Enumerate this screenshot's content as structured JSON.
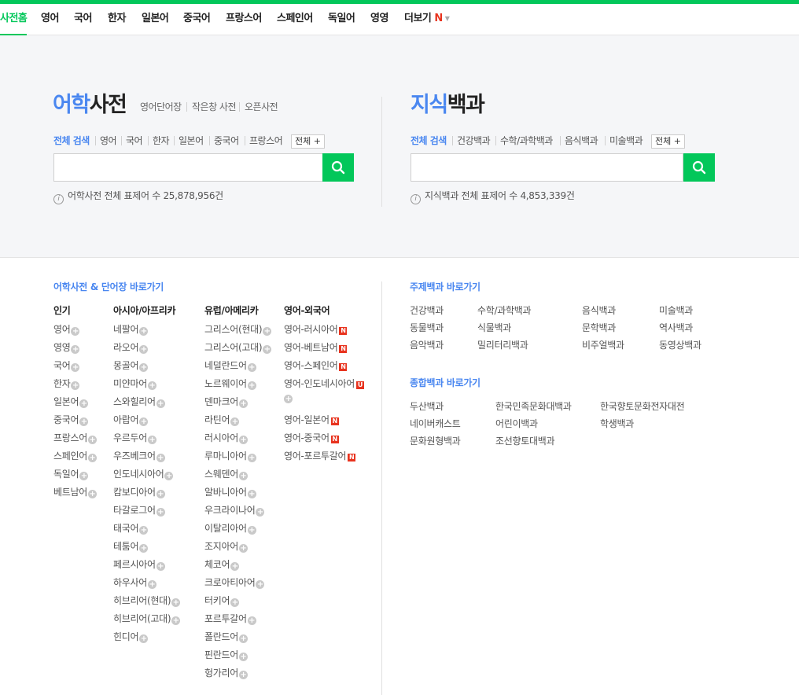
{
  "nav": {
    "tabs": [
      "사전홈",
      "영어",
      "국어",
      "한자",
      "일본어",
      "중국어",
      "프랑스어",
      "스페인어",
      "독일어",
      "영영"
    ],
    "more_label": "더보기",
    "more_badge": "N"
  },
  "language_dict": {
    "title_highlight": "어학",
    "title_rest": "사전",
    "sublinks": [
      "영어단어장",
      "작은창 사전",
      "오픈사전"
    ],
    "filters": [
      "전체 검색",
      "영어",
      "국어",
      "한자",
      "일본어",
      "중국어",
      "프랑스어"
    ],
    "all_button": "전체 +",
    "search_value": "",
    "search_icon": "search-icon",
    "count_text": "어학사전 전체 표제어 수 25,878,956건"
  },
  "knowledge": {
    "title_highlight": "지식",
    "title_rest": "백과",
    "filters": [
      "전체 검색",
      "건강백과",
      "수학/과학백과",
      "음식백과",
      "미술백과"
    ],
    "all_button": "전체 +",
    "search_value": "",
    "search_icon": "search-icon",
    "count_text": "지식백과 전체 표제어 수 4,853,339건"
  },
  "shortcuts": {
    "title": "어학사전 & 단어장 바로가기",
    "columns": [
      {
        "heading": "인기",
        "items": [
          "영어",
          "영영",
          "국어",
          "한자",
          "일본어",
          "중국어",
          "프랑스어",
          "스페인어",
          "독일어",
          "베트남어"
        ]
      },
      {
        "heading": "아시아/아프리카",
        "items": [
          "네팔어",
          "라오어",
          "몽골어",
          "미얀마어",
          "스와힐리어",
          "아랍어",
          "우르두어",
          "우즈베크어",
          "인도네시아어",
          "캄보디아어",
          "타갈로그어",
          "태국어",
          "테툼어",
          "페르시아어",
          "하우사어",
          "히브리어(현대)",
          "히브리어(고대)",
          "힌디어"
        ]
      },
      {
        "heading": "유럽/아메리카",
        "items": [
          "그리스어(현대)",
          "그리스어(고대)",
          "네덜란드어",
          "노르웨이어",
          "덴마크어",
          "라틴어",
          "러시아어",
          "루마니아어",
          "스웨덴어",
          "알바니아어",
          "우크라이나어",
          "이탈리아어",
          "조지아어",
          "체코어",
          "크로아티아어",
          "터키어",
          "포르투갈어",
          "폴란드어",
          "핀란드어",
          "헝가리어"
        ]
      },
      {
        "heading": "영어-외국어",
        "items": [
          {
            "label": "영어-러시아어",
            "badge": "N"
          },
          {
            "label": "영어-베트남어",
            "badge": "N"
          },
          {
            "label": "영어-스페인어",
            "badge": "N"
          },
          {
            "label": "영어-인도네시아어",
            "badge": "U"
          },
          {
            "label": "영어-일본어",
            "badge": "N"
          },
          {
            "label": "영어-중국어",
            "badge": "N"
          },
          {
            "label": "영어-포르투갈어",
            "badge": "N"
          }
        ]
      }
    ]
  },
  "topic_encyclopedia": {
    "title": "주제백과 바로가기",
    "links": [
      "건강백과",
      "수학/과학백과",
      "음식백과",
      "미술백과",
      "동물백과",
      "식물백과",
      "문학백과",
      "역사백과",
      "음악백과",
      "밀리터리백과",
      "비주얼백과",
      "동영상백과"
    ]
  },
  "general_encyclopedia": {
    "title": "종합백과 바로가기",
    "links": [
      "두산백과",
      "한국민족문화대백과",
      "한국향토문화전자대전",
      "네이버캐스트",
      "어린이백과",
      "학생백과",
      "문화원형백과",
      "조선향토대백과"
    ]
  },
  "colors": {
    "brand": "#03c75a",
    "accent": "#4a87f0",
    "badge": "#e8331e"
  }
}
